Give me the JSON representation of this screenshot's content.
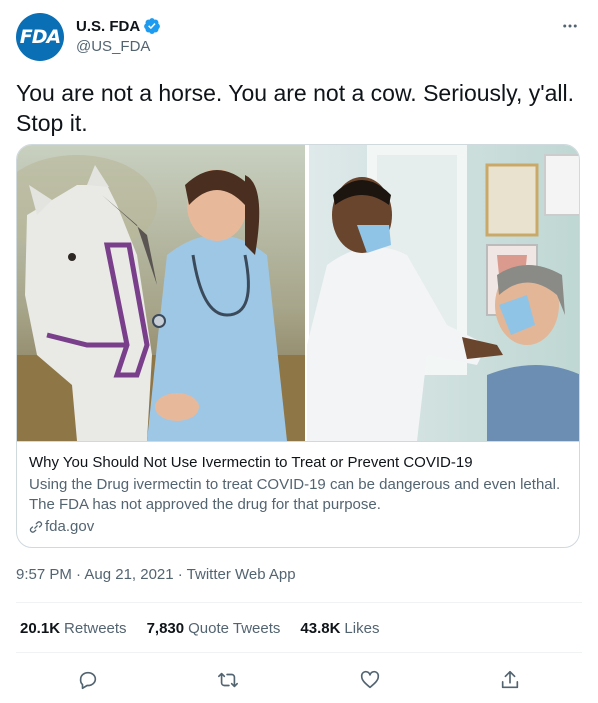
{
  "header": {
    "avatar_text": "FDA",
    "display_name": "U.S. FDA",
    "handle": "@US_FDA",
    "verified_color": "#1d9bf0",
    "more_icon": "more-horizontal-icon"
  },
  "tweet": {
    "text": "You are not a horse. You are not a cow. Seriously, y'all. Stop it."
  },
  "card": {
    "title": "Why You Should Not Use Ivermectin to Treat or Prevent COVID-19",
    "description": "Using the Drug ivermectin to treat COVID-19 can be dangerous and even lethal. The FDA has not approved the drug for that purpose.",
    "domain": "fda.gov"
  },
  "meta": {
    "timestamp": "9:57 PM · Aug 21, 2021 · Twitter Web App"
  },
  "stats": {
    "retweets_count": "20.1K",
    "retweets_label": "Retweets",
    "quotes_count": "7,830",
    "quotes_label": "Quote Tweets",
    "likes_count": "43.8K",
    "likes_label": "Likes"
  },
  "actions": [
    "reply-icon",
    "retweet-icon",
    "like-icon",
    "share-icon"
  ],
  "colors": {
    "brand": "#0a6fb5",
    "text_primary": "#0f1419",
    "text_secondary": "#536471",
    "border": "#cfd9de",
    "icon": "#536471"
  }
}
